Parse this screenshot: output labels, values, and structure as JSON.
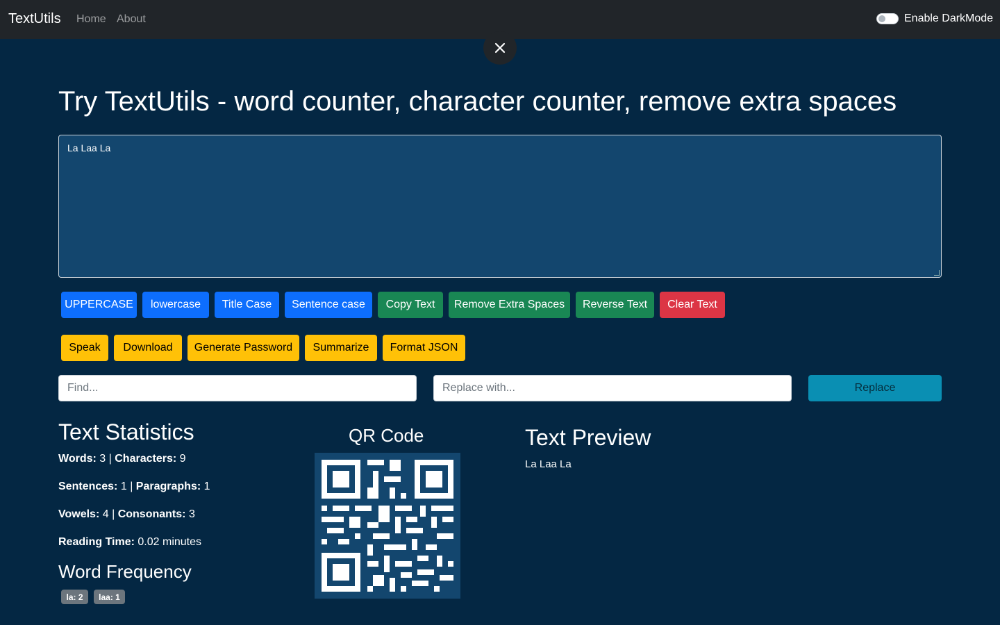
{
  "navbar": {
    "brand": "TextUtils",
    "links": [
      "Home",
      "About"
    ],
    "darkmode_label": "Enable DarkMode"
  },
  "close_icon": "close-icon",
  "page_title": "Try TextUtils - word counter, character counter, remove extra spaces",
  "textarea": {
    "value": "La Laa La"
  },
  "buttons_row1": [
    {
      "label": "UPPERCASE",
      "style": "primary"
    },
    {
      "label": "lowercase",
      "style": "primary"
    },
    {
      "label": "Title Case",
      "style": "primary"
    },
    {
      "label": "Sentence case",
      "style": "primary"
    },
    {
      "label": "Copy Text",
      "style": "success"
    },
    {
      "label": "Remove Extra Spaces",
      "style": "success"
    },
    {
      "label": "Reverse Text",
      "style": "success"
    },
    {
      "label": "Clear Text",
      "style": "danger"
    }
  ],
  "buttons_row2": [
    {
      "label": "Speak",
      "style": "warning"
    },
    {
      "label": "Download",
      "style": "warning"
    },
    {
      "label": "Generate Password",
      "style": "warning"
    },
    {
      "label": "Summarize",
      "style": "warning"
    },
    {
      "label": "Format JSON",
      "style": "warning"
    }
  ],
  "find_replace": {
    "find_placeholder": "Find...",
    "replace_placeholder": "Replace with...",
    "replace_label": "Replace"
  },
  "stats": {
    "heading": "Text Statistics",
    "words_label": "Words:",
    "words": "3",
    "chars_label": "Characters:",
    "chars": "9",
    "sentences_label": "Sentences:",
    "sentences": "1",
    "paragraphs_label": "Paragraphs:",
    "paragraphs": "1",
    "vowels_label": "Vowels:",
    "vowels": "4",
    "consonants_label": "Consonants:",
    "consonants": "3",
    "reading_label": "Reading Time:",
    "reading": "0.02 minutes",
    "separator": "|"
  },
  "word_frequency": {
    "heading": "Word Frequency",
    "badges": [
      "la: 2",
      "laa: 1"
    ]
  },
  "qr": {
    "heading": "QR Code"
  },
  "preview": {
    "heading": "Text Preview",
    "text": "La Laa La"
  },
  "colors": {
    "background": "#042743",
    "navbar": "#212529",
    "textarea": "#13466e",
    "primary": "#0d6efd",
    "success": "#198754",
    "danger": "#dc3545",
    "warning": "#ffc107",
    "info": "#0a8fb3"
  }
}
